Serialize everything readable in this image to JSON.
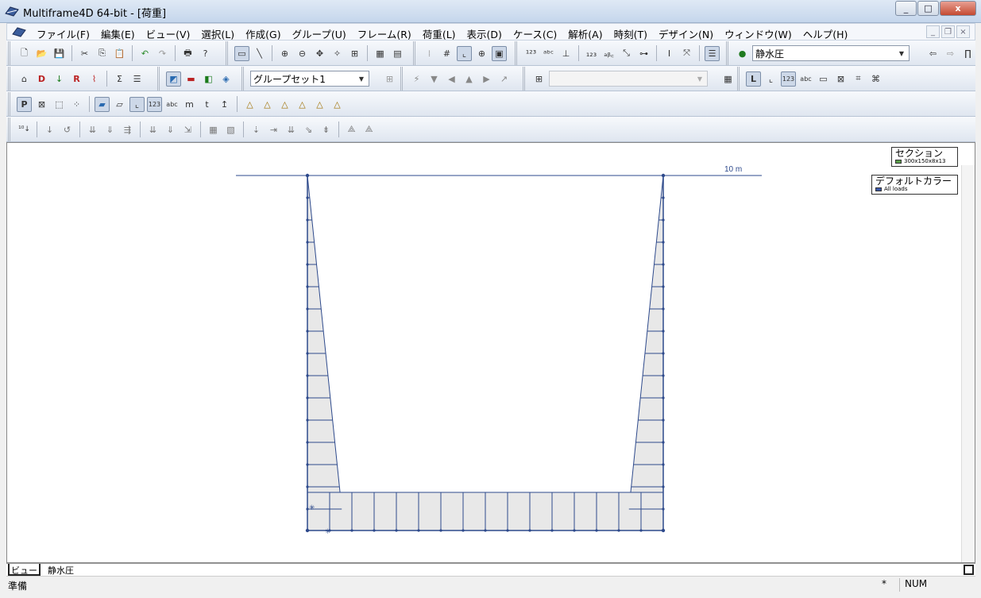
{
  "window": {
    "title": "Multiframe4D 64-bit - [荷重]",
    "min_label": "_",
    "max_label": "□",
    "close_label": "x"
  },
  "menu": {
    "items": [
      "ファイル(F)",
      "編集(E)",
      "ビュー(V)",
      "選択(L)",
      "作成(G)",
      "グループ(U)",
      "フレーム(R)",
      "荷重(L)",
      "表示(D)",
      "ケース(C)",
      "解析(A)",
      "時刻(T)",
      "デザイン(N)",
      "ウィンドウ(W)",
      "ヘルプ(H)"
    ]
  },
  "toolbar": {
    "load_case": "静水圧",
    "group_set": "グループセット1",
    "group_combo": ""
  },
  "view": {
    "scale_label": "10 m",
    "legend_section_title": "セクション",
    "legend_section_item": "300x150x8x13",
    "legend_color_title": "デフォルトカラー",
    "legend_color_item": "All loads",
    "colors": {
      "member": "#2e4a8c",
      "load_fill": "#e8e8e8",
      "section_swatch": "#5a9e4a",
      "load_swatch": "#3a57a8"
    }
  },
  "tabs": {
    "active": "ビュー",
    "other": "静水圧"
  },
  "status": {
    "ready": "準備",
    "star": "*",
    "num": "NUM"
  }
}
